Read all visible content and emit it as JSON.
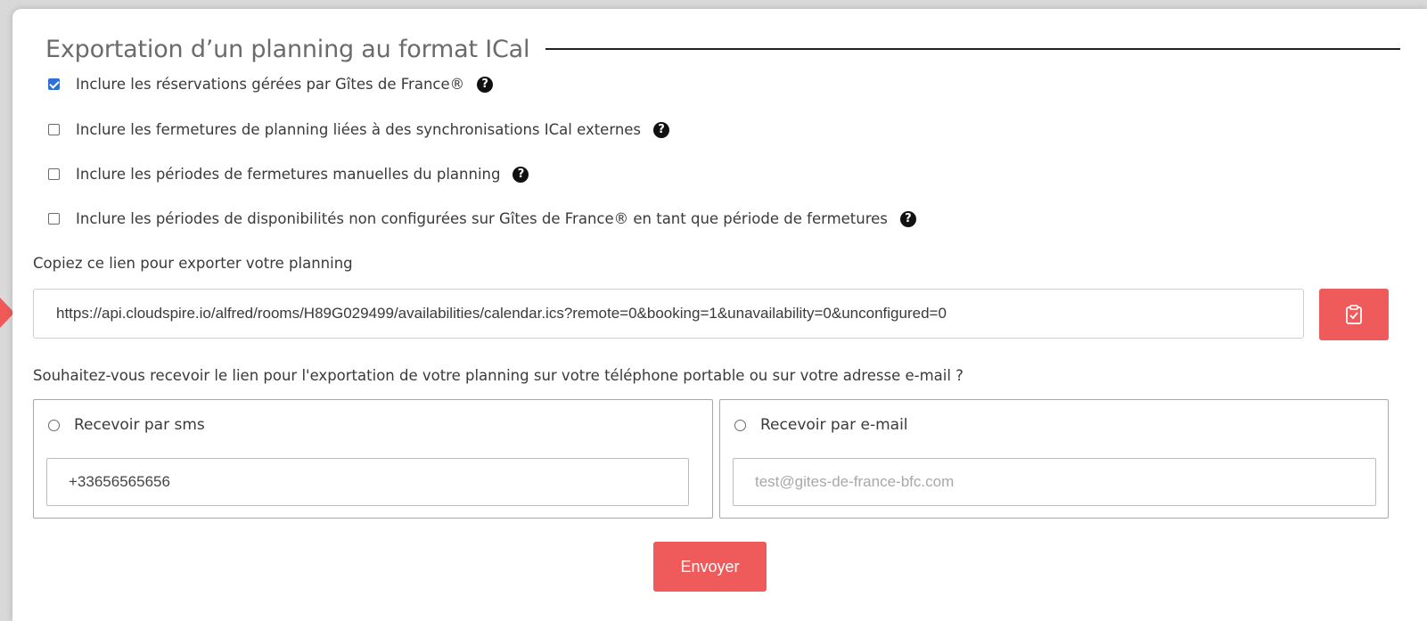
{
  "section": {
    "title": "Exportation d’un planning au format ICal"
  },
  "options": [
    {
      "label": "Inclure les réservations gérées par Gîtes de France®",
      "checked": true,
      "help_icon": "question-circle-icon"
    },
    {
      "label": "Inclure les fermetures de planning liées à des synchronisations ICal externes",
      "checked": false,
      "help_icon": "question-circle-icon"
    },
    {
      "label": "Inclure les périodes de fermetures manuelles du planning",
      "checked": false,
      "help_icon": "question-circle-icon"
    },
    {
      "label": "Inclure les périodes de disponibilités non configurées sur Gîtes de France® en tant que période de fermetures",
      "checked": false,
      "help_icon": "question-circle-icon"
    }
  ],
  "help_glyph": "?",
  "link": {
    "label": "Copiez ce lien pour exporter votre planning",
    "value": "https://api.cloudspire.io/alfred/rooms/H89G029499/availabilities/calendar.ics?remote=0&booking=1&unavailability=0&unconfigured=0",
    "copy_icon": "clipboard-check-icon"
  },
  "receive": {
    "question": "Souhaitez-vous recevoir le lien pour l'exportation de votre planning sur votre téléphone portable ou sur votre adresse e-mail ?",
    "sms": {
      "label": "Recevoir par sms",
      "value": "+33656565656",
      "selected": false
    },
    "email": {
      "label": "Recevoir par e-mail",
      "placeholder": "test@gites-de-france-bfc.com",
      "value": "",
      "selected": false
    },
    "send_label": "Envoyer"
  },
  "colors": {
    "accent": "#ef5a5a",
    "checkbox": "#2f6fdc"
  }
}
